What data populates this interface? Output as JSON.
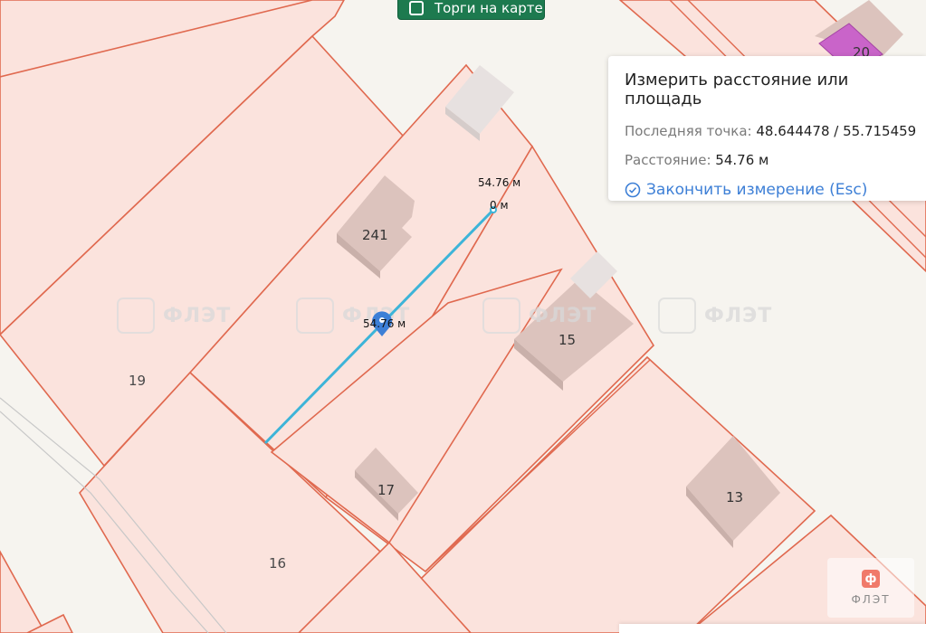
{
  "top_button": {
    "label": "Торги на карте",
    "checked": false,
    "color": "#1d7a4f"
  },
  "measure_panel": {
    "title": "Измерить расстояние или площадь",
    "last_point_label": "Последняя точка:",
    "last_point_value": "48.644478 / 55.715459",
    "distance_label": "Расстояние:",
    "distance_value": "54.76 м",
    "finish_label": "Закончить измерение (Esc)",
    "finish_icon": "check-circle-icon",
    "accent": "#3d7fd6"
  },
  "measurement": {
    "end_label": "54.76 м",
    "start_label": "0 м",
    "mid_label": "54.76 м",
    "line_color": "#3db4d8",
    "marker_color": "#3d7fd6"
  },
  "plots": [
    "19",
    "16"
  ],
  "buildings": [
    "241",
    "15",
    "17",
    "13",
    "20"
  ],
  "watermark": "ФЛЭТ",
  "logo": {
    "mark": "ф",
    "name": "ФЛЭТ"
  },
  "colors": {
    "plot_fill": "#fbe3dd",
    "plot_stroke": "#e0694f",
    "building": "#dcc3bd",
    "highlight": "#c964c9"
  }
}
